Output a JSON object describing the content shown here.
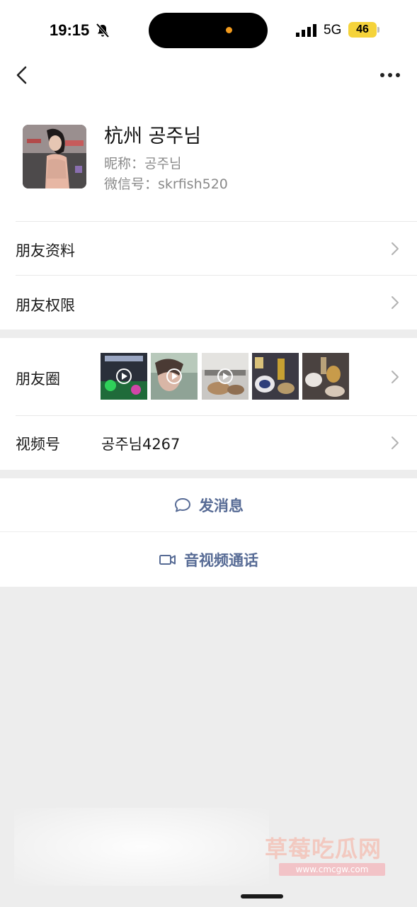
{
  "status_bar": {
    "time": "19:15",
    "network": "5G",
    "battery": "46",
    "icons": [
      "bell-slash-icon",
      "signal-icon"
    ]
  },
  "nav": {
    "back_icon": "chevron-left-icon",
    "more_icon": "more-dots-icon"
  },
  "profile": {
    "name": "杭州 공주님",
    "nickname": "昵称：공주님",
    "wechat_id": "微信号：skrfish520"
  },
  "menu": {
    "friend_info": "朋友资料",
    "friend_permissions": "朋友权限"
  },
  "moments": {
    "label": "朋友圈",
    "thumbnails": [
      {
        "name": "moments-thumb-1",
        "video": true
      },
      {
        "name": "moments-thumb-2",
        "video": true
      },
      {
        "name": "moments-thumb-3",
        "video": true
      },
      {
        "name": "moments-thumb-4",
        "video": false
      },
      {
        "name": "moments-thumb-5",
        "video": false
      }
    ]
  },
  "channels": {
    "label": "视频号",
    "value": "공주님4267"
  },
  "actions": {
    "send_message": "发消息",
    "av_call": "音视频通话"
  },
  "watermark": {
    "title": "草莓吃瓜网",
    "url": "www.cmcgw.com"
  },
  "colors": {
    "link": "#576b95",
    "background": "#ededed",
    "battery": "#f5d33a",
    "island_dot": "#f39b1d"
  }
}
